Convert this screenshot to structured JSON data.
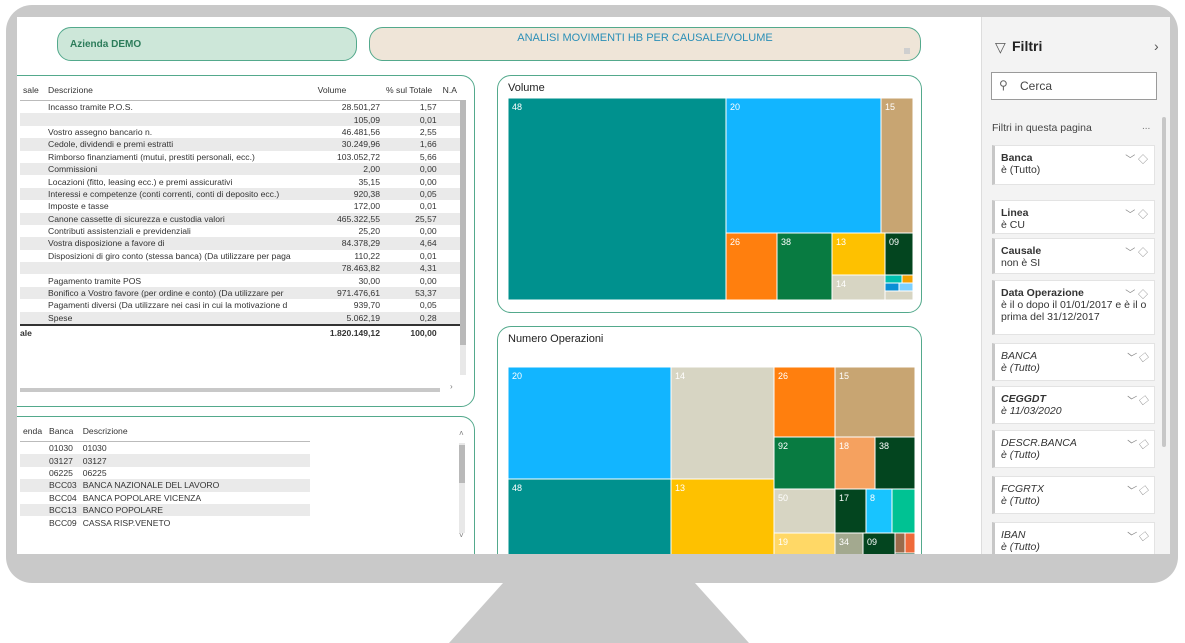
{
  "header": {
    "company": "Azienda DEMO",
    "title": "ANALISI MOVIMENTI HB PER CAUSALE/VOLUME"
  },
  "table1": {
    "headers": [
      "sale",
      "Descrizione",
      "Volume",
      "% sul Totale",
      "N.A"
    ],
    "rows": [
      {
        "d": "Incasso tramite P.O.S.",
        "v": "28.501,27",
        "p": "1,57"
      },
      {
        "d": "",
        "v": "105,09",
        "p": "0,01"
      },
      {
        "d": "Vostro assegno bancario n.",
        "v": "46.481,56",
        "p": "2,55"
      },
      {
        "d": "Cedole, dividendi e premi estratti",
        "v": "30.249,96",
        "p": "1,66"
      },
      {
        "d": "Rimborso finanziamenti (mutui, prestiti personali, ecc.)",
        "v": "103.052,72",
        "p": "5,66"
      },
      {
        "d": "Commissioni",
        "v": "2,00",
        "p": "0,00"
      },
      {
        "d": "Locazioni (fitto, leasing ecc.) e premi assicurativi",
        "v": "35,15",
        "p": "0,00"
      },
      {
        "d": "Interessi e competenze (conti correnti, conti di deposito ecc.)",
        "v": "920,38",
        "p": "0,05"
      },
      {
        "d": "Imposte e tasse",
        "v": "172,00",
        "p": "0,01"
      },
      {
        "d": "Canone cassette di sicurezza e custodia valori",
        "v": "465.322,55",
        "p": "25,57"
      },
      {
        "d": "Contributi assistenziali e previdenziali",
        "v": "25,20",
        "p": "0,00"
      },
      {
        "d": "Vostra disposizione a favore di",
        "v": "84.378,29",
        "p": "4,64"
      },
      {
        "d": "Disposizioni di giro conto (stessa banca) (Da utilizzare per paga",
        "v": "110,22",
        "p": "0,01"
      },
      {
        "d": "",
        "v": "78.463,82",
        "p": "4,31"
      },
      {
        "d": "Pagamento tramite POS",
        "v": "30,00",
        "p": "0,00"
      },
      {
        "d": "Bonifico a Vostro favore (per ordine e conto) (Da utilizzare per",
        "v": "971.476,61",
        "p": "53,37"
      },
      {
        "d": "Pagamenti diversi (Da utilizzare nei casi in cui la motivazione d",
        "v": "939,70",
        "p": "0,05"
      },
      {
        "d": "Spese",
        "v": "5.062,19",
        "p": "0,28"
      }
    ],
    "total": {
      "label": "ale",
      "v": "1.820.149,12",
      "p": "100,00"
    }
  },
  "table2": {
    "headers": [
      "enda",
      "Banca",
      "Descrizione"
    ],
    "rows": [
      {
        "b": "01030",
        "d": "01030"
      },
      {
        "b": "03127",
        "d": "03127"
      },
      {
        "b": "06225",
        "d": "06225"
      },
      {
        "b": "BCC03",
        "d": "BANCA NAZIONALE DEL LAVORO"
      },
      {
        "b": "BCC04",
        "d": "BANCA POPOLARE VICENZA"
      },
      {
        "b": "BCC13",
        "d": "BANCO POPOLARE"
      },
      {
        "b": "BCC09",
        "d": "CASSA RISP.VENETO"
      }
    ]
  },
  "treemap_volume": {
    "title": "Volume",
    "tiles": [
      "48",
      "20",
      "15",
      "26",
      "38",
      "13",
      "09",
      "14"
    ]
  },
  "treemap_count": {
    "title": "Numero Operazioni",
    "tiles": [
      "20",
      "14",
      "26",
      "15",
      "92",
      "18",
      "38",
      "48",
      "13",
      "50",
      "17",
      "8",
      "19",
      "34",
      "09"
    ]
  },
  "filters": {
    "title": "Filtri",
    "search": "Cerca",
    "section": "Filtri in questa pagina",
    "more": "...",
    "items": [
      {
        "name": "Banca",
        "value": "è (Tutto)"
      },
      {
        "name": "Linea",
        "value": "è CU"
      },
      {
        "name": "Causale",
        "value": "non è SI"
      },
      {
        "name": "Data Operazione",
        "value": "è il o dopo il 01/01/2017 e è il o prima del 31/12/2017"
      },
      {
        "name": "BANCA",
        "value": "è (Tutto)"
      },
      {
        "name": "CEGGDT",
        "value": "è 11/03/2020"
      },
      {
        "name": "DESCR.BANCA",
        "value": "è (Tutto)"
      },
      {
        "name": "FCGRTX",
        "value": "è (Tutto)"
      },
      {
        "name": "IBAN",
        "value": "è (Tutto)"
      }
    ]
  },
  "colors": {
    "teal": "#00918e",
    "blue": "#12b5ff",
    "tan": "#c8a572",
    "orange": "#ff7f0e",
    "green": "#087b41",
    "darkgreen": "#03451f",
    "yellow": "#fec100",
    "beige": "#d7d5c3",
    "accent": "#53a98c"
  }
}
